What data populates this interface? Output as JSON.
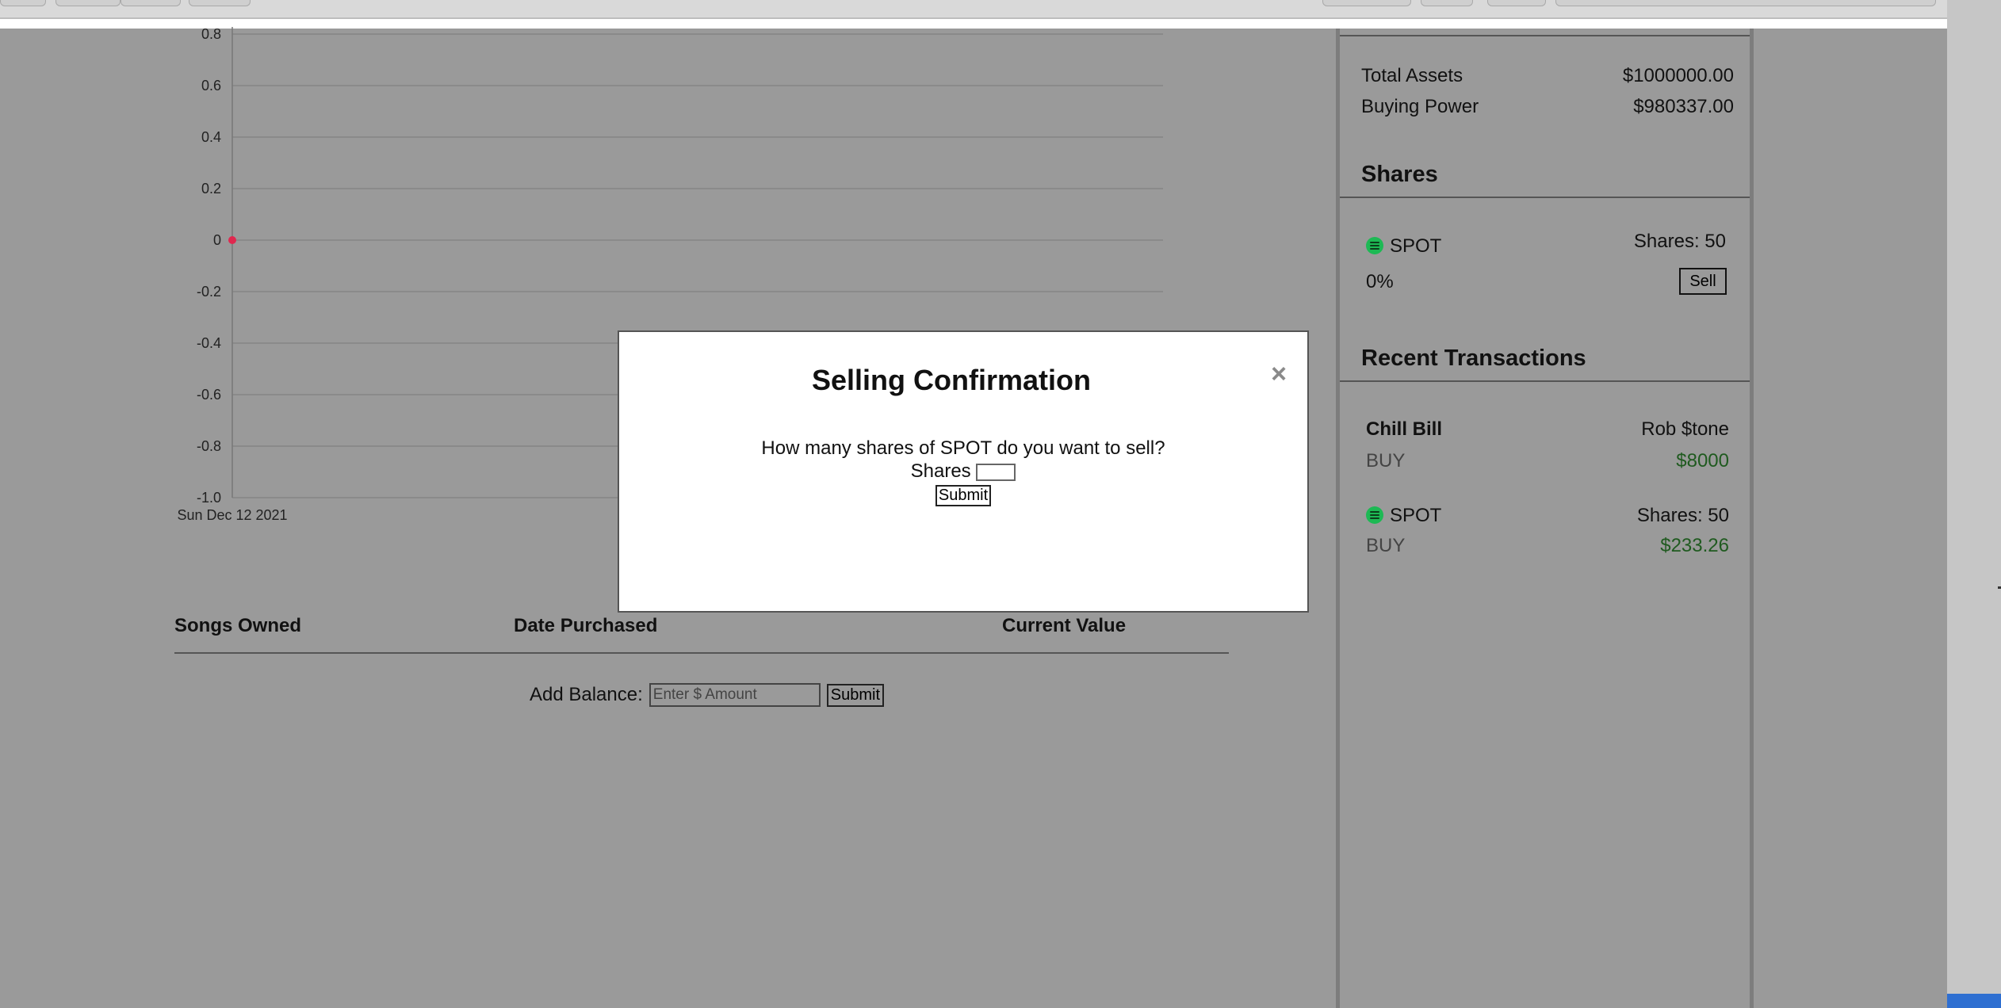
{
  "chart_data": {
    "type": "scatter",
    "x": [
      "Sun Dec 12 2021"
    ],
    "y": [
      0
    ],
    "yticks": [
      "0.8",
      "0.6",
      "0.4",
      "0.2",
      "0",
      "-0.2",
      "-0.4",
      "-0.6",
      "-0.8",
      "-1.0"
    ],
    "ylim": [
      -1.0,
      0.8
    ],
    "xtick_label": "Sun Dec 12 2021",
    "point_color": "#e0284f",
    "grid": true
  },
  "table": {
    "headers": [
      "Songs Owned",
      "Date Purchased",
      "Current Value"
    ],
    "rows": []
  },
  "add_balance": {
    "label": "Add Balance:",
    "placeholder": "Enter $ Amount",
    "submit_label": "Submit"
  },
  "sidebar": {
    "total_assets_label": "Total Assets",
    "total_assets_value": "$1000000.00",
    "buying_power_label": "Buying Power",
    "buying_power_value": "$980337.00",
    "shares_heading": "Shares",
    "share": {
      "ticker": "SPOT",
      "count_label": "Shares: 50",
      "change": "0%",
      "sell_label": "Sell"
    },
    "transactions_heading": "Recent Transactions",
    "transactions": [
      {
        "title": "Chill Bill",
        "artist": "Rob $tone",
        "type": "BUY",
        "amount": "$8000"
      },
      {
        "title": "SPOT",
        "artist": "Shares: 50",
        "type": "BUY",
        "amount": "$233.26"
      }
    ]
  },
  "modal": {
    "title": "Selling Confirmation",
    "close": "×",
    "question": "How many shares of SPOT do you want to sell?",
    "shares_label": "Shares",
    "submit_label": "Submit"
  },
  "colors": {
    "spotify_green": "#1db954",
    "positive_amount": "#1f5a1f"
  }
}
